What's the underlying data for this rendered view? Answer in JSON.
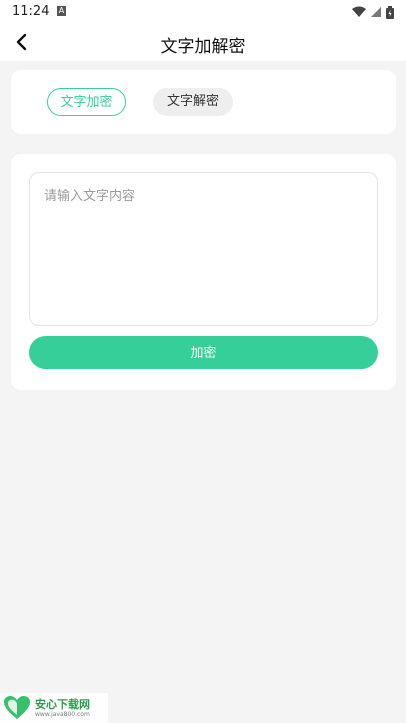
{
  "status_bar": {
    "time": "11:24",
    "notification_icon": "a-icon",
    "wifi_icon": "wifi-icon",
    "signal_icon": "signal-icon",
    "battery_icon": "battery-icon"
  },
  "header": {
    "back_icon": "chevron-left-icon",
    "title": "文字加解密"
  },
  "tabs": [
    {
      "label": "文字加密",
      "selected": true
    },
    {
      "label": "文字解密",
      "selected": false
    }
  ],
  "form": {
    "input_value": "",
    "input_placeholder": "请输入文字内容",
    "submit_label": "加密"
  },
  "watermark": {
    "title": "安心下载网",
    "url": "www.java800.com"
  },
  "colors": {
    "accent": "#36cf9a",
    "background": "#f4f4f4",
    "card": "#ffffff"
  }
}
